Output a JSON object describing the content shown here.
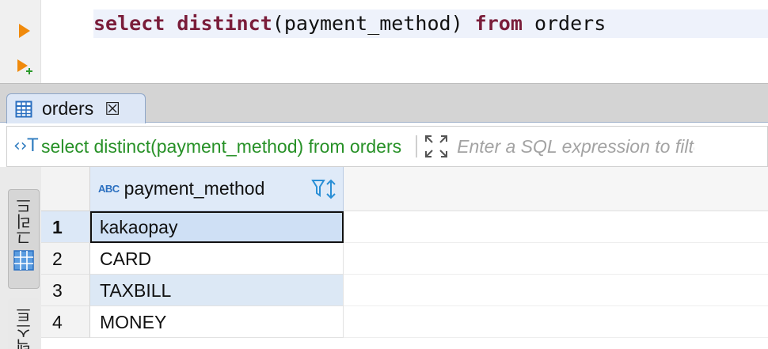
{
  "editor": {
    "code_tokens": [
      {
        "text": "select",
        "kw": true
      },
      {
        "text": " ",
        "kw": false
      },
      {
        "text": "distinct",
        "kw": true
      },
      {
        "text": "(payment_method) ",
        "kw": false
      },
      {
        "text": "from",
        "kw": true
      },
      {
        "text": " orders",
        "kw": false
      }
    ],
    "keyword_color": "#7a1d3a",
    "run_button_icon": "play-icon",
    "run_new_tab_icon": "play-plus-icon"
  },
  "result_tab": {
    "label": "orders",
    "icon": "table-grid-icon",
    "close_icon": "close-icon",
    "close_symbol": "☒"
  },
  "filter_bar": {
    "query": "select distinct(payment_method) from orders",
    "query_color": "#279127",
    "placeholder": "Enter a SQL expression to filter results"
  },
  "side_panel": {
    "grid_label": "그리드",
    "text_label": "텍스트"
  },
  "grid": {
    "column": {
      "type_badge": "ABC",
      "name": "payment_method"
    },
    "rows": [
      {
        "num": "1",
        "value": "kakaopay"
      },
      {
        "num": "2",
        "value": "CARD"
      },
      {
        "num": "3",
        "value": "TAXBILL"
      },
      {
        "num": "4",
        "value": "MONEY"
      }
    ]
  }
}
